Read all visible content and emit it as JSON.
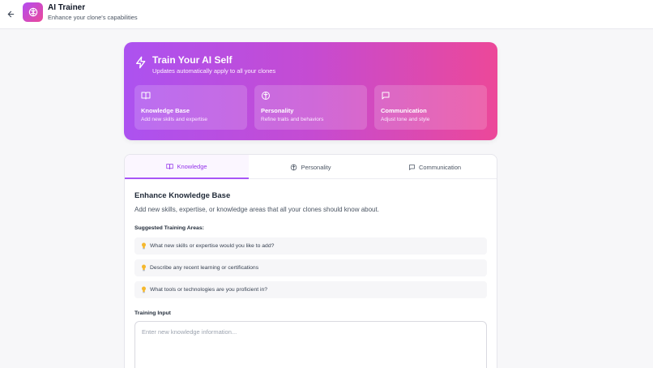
{
  "header": {
    "title": "AI Trainer",
    "subtitle": "Enhance your clone's capabilities",
    "app_icon": "brain-icon",
    "back_icon": "arrow-left-icon"
  },
  "hero": {
    "title": "Train Your AI Self",
    "subtitle": "Updates automatically apply to all your clones",
    "icon": "lightning-icon",
    "cards": [
      {
        "icon": "book-icon",
        "title": "Knowledge Base",
        "desc": "Add new skills and expertise"
      },
      {
        "icon": "brain-icon",
        "title": "Personality",
        "desc": "Refine traits and behaviors"
      },
      {
        "icon": "chat-icon",
        "title": "Communication",
        "desc": "Adjust tone and style"
      }
    ],
    "colors": {
      "gradient_start": "#ac52f0",
      "gradient_end": "#ec4899"
    }
  },
  "tabs": [
    {
      "label": "Knowledge",
      "icon": "book-icon",
      "active": true
    },
    {
      "label": "Personality",
      "icon": "brain-icon",
      "active": false
    },
    {
      "label": "Communication",
      "icon": "chat-icon",
      "active": false
    }
  ],
  "knowledge": {
    "title": "Enhance Knowledge Base",
    "description": "Add new skills, expertise, or knowledge areas that all your clones should know about.",
    "suggested_label": "Suggested Training Areas:",
    "suggestions": [
      "What new skills or expertise would you like to add?",
      "Describe any recent learning or certifications",
      "What tools or technologies are you proficient in?"
    ],
    "input_label": "Training Input",
    "input_placeholder": "Enter new knowledge information...",
    "input_value": ""
  },
  "colors": {
    "accent": "#a855f7",
    "accent_text": "#9333ea",
    "bulb": "#f5b82e"
  }
}
